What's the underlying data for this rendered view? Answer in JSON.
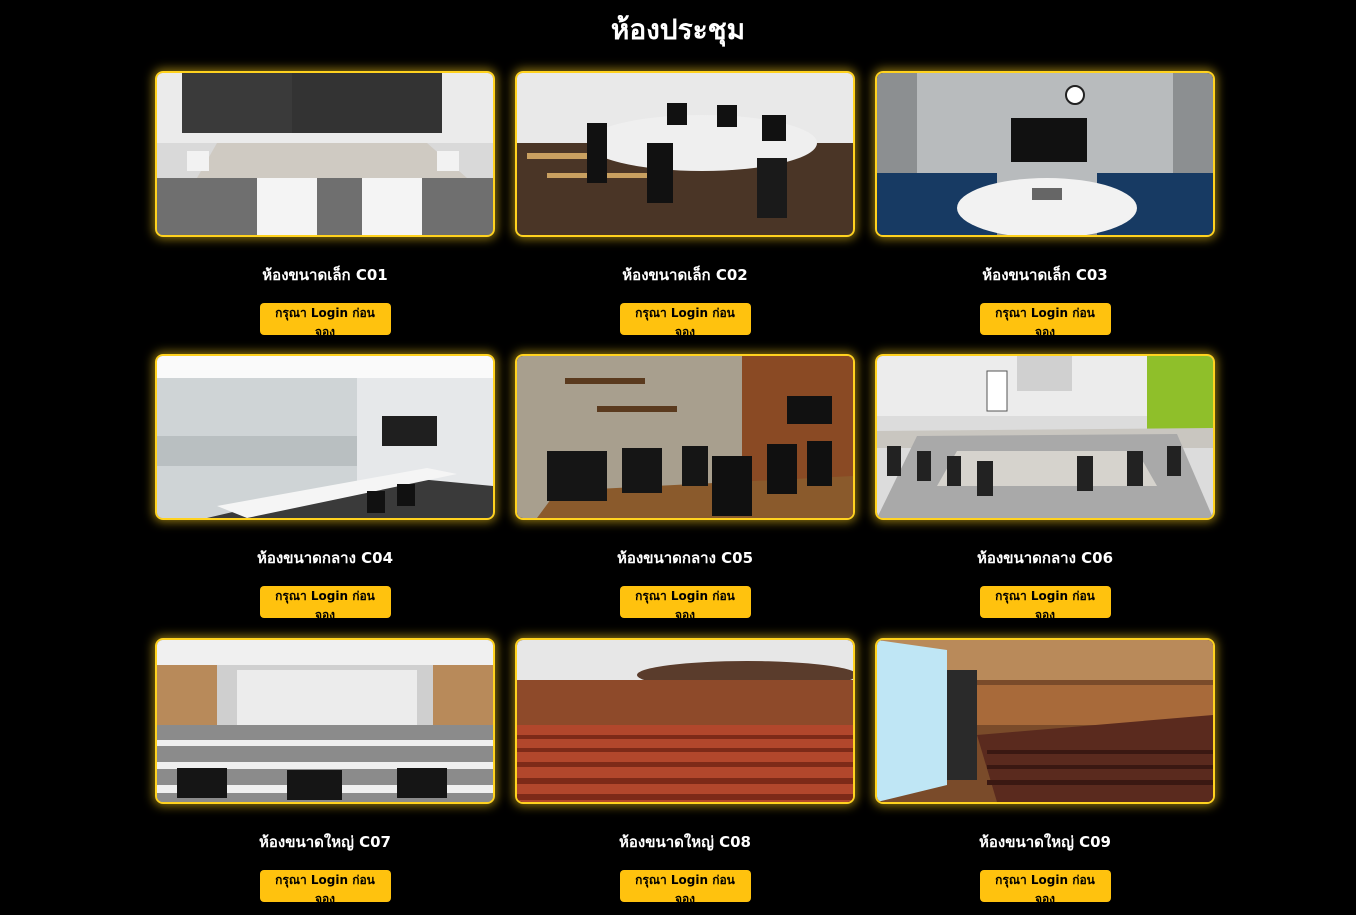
{
  "page": {
    "title": "ห้องประชุม"
  },
  "rooms": [
    {
      "name": "ห้องขนาดเล็ก C01",
      "button": "กรุณา Login ก่อนจอง",
      "photo": "meeting-room-small-c01-photo"
    },
    {
      "name": "ห้องขนาดเล็ก C02",
      "button": "กรุณา Login ก่อนจอง",
      "photo": "meeting-room-small-c02-photo"
    },
    {
      "name": "ห้องขนาดเล็ก C03",
      "button": "กรุณา Login ก่อนจอง",
      "photo": "meeting-room-small-c03-photo"
    },
    {
      "name": "ห้องขนาดกลาง C04",
      "button": "กรุณา Login ก่อนจอง",
      "photo": "meeting-room-medium-c04-photo"
    },
    {
      "name": "ห้องขนาดกลาง C05",
      "button": "กรุณา Login ก่อนจอง",
      "photo": "meeting-room-medium-c05-photo"
    },
    {
      "name": "ห้องขนาดกลาง C06",
      "button": "กรุณา Login ก่อนจอง",
      "photo": "meeting-room-medium-c06-photo"
    },
    {
      "name": "ห้องขนาดใหญ่ C07",
      "button": "กรุณา Login ก่อนจอง",
      "photo": "meeting-room-large-c07-photo"
    },
    {
      "name": "ห้องขนาดใหญ่ C08",
      "button": "กรุณา Login ก่อนจอง",
      "photo": "meeting-room-large-c08-photo"
    },
    {
      "name": "ห้องขนาดใหญ่ C09",
      "button": "กรุณา Login ก่อนจอง",
      "photo": "meeting-room-large-c09-photo"
    }
  ],
  "colors": {
    "accent": "#ffc20e",
    "border": "#ffd21f",
    "background": "#000000"
  }
}
